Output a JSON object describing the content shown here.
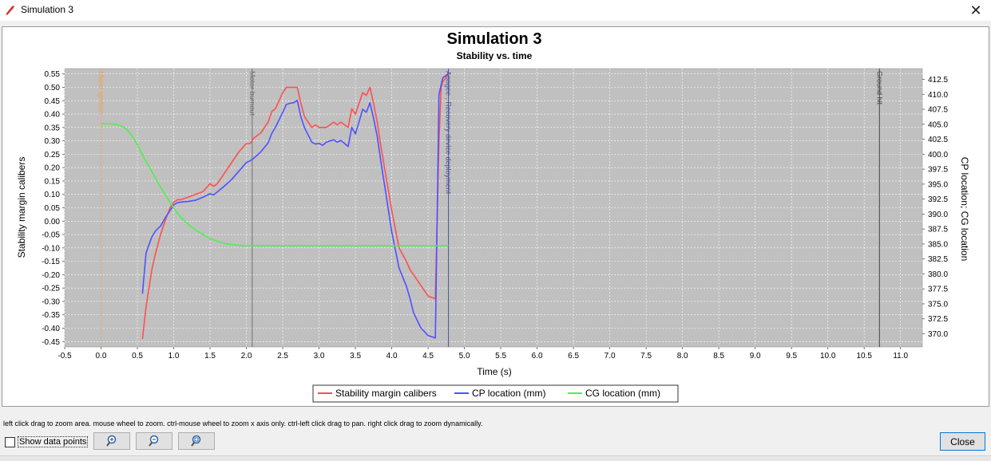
{
  "window": {
    "title": "Simulation 3",
    "close_glyph": "✕"
  },
  "chart_data": {
    "type": "line",
    "title": "Simulation 3",
    "subtitle": "Stability vs. time",
    "xlabel": "Time (s)",
    "ylabel_left": "Stability margin calibers",
    "ylabel_right": "CP location; CG location",
    "xlim": [
      -0.5,
      11.3
    ],
    "ylim_left": [
      -0.47,
      0.57
    ],
    "ylim_right": [
      367.8,
      414.3
    ],
    "grid": true,
    "legend_position": "bottom",
    "x_ticks": [
      "-0.5",
      "0.0",
      "0.5",
      "1.0",
      "1.5",
      "2.0",
      "2.5",
      "3.0",
      "3.5",
      "4.0",
      "4.5",
      "5.0",
      "5.5",
      "6.0",
      "6.5",
      "7.0",
      "7.5",
      "8.0",
      "8.5",
      "9.0",
      "9.5",
      "10.0",
      "10.5",
      "11.0"
    ],
    "y_left_ticks": [
      "0.55",
      "0.50",
      "0.45",
      "0.40",
      "0.35",
      "0.30",
      "0.25",
      "0.20",
      "0.15",
      "0.10",
      "0.05",
      "0.00",
      "-0.05",
      "-0.10",
      "-0.15",
      "-0.20",
      "-0.25",
      "-0.30",
      "-0.35",
      "-0.40",
      "-0.45"
    ],
    "y_right_ticks": [
      "412.5",
      "410.0",
      "407.5",
      "405.0",
      "402.5",
      "400.0",
      "397.5",
      "395.0",
      "392.5",
      "390.0",
      "387.5",
      "385.0",
      "382.5",
      "380.0",
      "377.5",
      "375.0",
      "372.5",
      "370.0"
    ],
    "events": [
      {
        "label": "Motor ignition",
        "x": 0.0,
        "color": "#e8a45c"
      },
      {
        "label": "Motor burnout",
        "x": 2.08,
        "color": "#707070"
      },
      {
        "label": "Apogee , Recovery device deployment",
        "x": 4.78,
        "color": "#5050a0"
      },
      {
        "label": "Ground hit",
        "x": 10.71,
        "color": "#444444"
      }
    ],
    "series": [
      {
        "name": "Stability margin calibers",
        "axis": "left",
        "color": "#ff4f4f",
        "x": [
          0.57,
          0.62,
          0.7,
          0.75,
          0.82,
          0.88,
          0.95,
          1.0,
          1.05,
          1.1,
          1.2,
          1.3,
          1.4,
          1.5,
          1.55,
          1.6,
          1.7,
          1.8,
          1.9,
          2.0,
          2.05,
          2.1,
          2.2,
          2.3,
          2.35,
          2.4,
          2.5,
          2.55,
          2.6,
          2.65,
          2.7,
          2.75,
          2.8,
          2.9,
          2.95,
          3.0,
          3.05,
          3.1,
          3.2,
          3.25,
          3.3,
          3.4,
          3.45,
          3.5,
          3.55,
          3.6,
          3.65,
          3.7,
          3.75,
          3.8,
          3.85,
          3.9,
          4.0,
          4.1,
          4.2,
          4.25,
          4.3,
          4.4,
          4.5,
          4.6,
          4.65,
          4.68,
          4.7,
          4.73,
          4.78
        ],
        "values": [
          -0.44,
          -0.32,
          -0.18,
          -0.12,
          -0.05,
          0.0,
          0.05,
          0.07,
          0.08,
          0.08,
          0.09,
          0.1,
          0.11,
          0.14,
          0.13,
          0.14,
          0.18,
          0.22,
          0.26,
          0.29,
          0.29,
          0.31,
          0.33,
          0.37,
          0.41,
          0.42,
          0.48,
          0.5,
          0.5,
          0.5,
          0.5,
          0.44,
          0.39,
          0.35,
          0.36,
          0.35,
          0.35,
          0.35,
          0.37,
          0.36,
          0.37,
          0.35,
          0.42,
          0.4,
          0.44,
          0.48,
          0.47,
          0.5,
          0.44,
          0.37,
          0.28,
          0.2,
          0.04,
          -0.1,
          -0.15,
          -0.18,
          -0.2,
          -0.24,
          -0.28,
          -0.29,
          0.3,
          0.5,
          0.52,
          0.53,
          0.55
        ]
      },
      {
        "name": "CP location (mm)",
        "axis": "right",
        "color": "#5050ff",
        "x": [
          0.57,
          0.62,
          0.7,
          0.75,
          0.82,
          0.88,
          0.95,
          1.0,
          1.05,
          1.1,
          1.2,
          1.3,
          1.4,
          1.5,
          1.55,
          1.6,
          1.7,
          1.8,
          1.9,
          2.0,
          2.05,
          2.1,
          2.2,
          2.3,
          2.35,
          2.4,
          2.5,
          2.55,
          2.6,
          2.65,
          2.7,
          2.75,
          2.8,
          2.9,
          2.95,
          3.0,
          3.05,
          3.1,
          3.2,
          3.25,
          3.3,
          3.4,
          3.45,
          3.5,
          3.55,
          3.6,
          3.65,
          3.7,
          3.75,
          3.8,
          3.85,
          3.9,
          4.0,
          4.1,
          4.2,
          4.25,
          4.3,
          4.4,
          4.5,
          4.6,
          4.65,
          4.68,
          4.7,
          4.73,
          4.78
        ],
        "values": [
          376.7,
          383.5,
          386.2,
          387.2,
          388.0,
          389.3,
          390.6,
          391.5,
          391.9,
          392.0,
          392.1,
          392.3,
          392.8,
          393.4,
          393.2,
          393.7,
          394.7,
          395.8,
          397.2,
          398.6,
          398.9,
          399.3,
          400.4,
          401.9,
          403.5,
          404.5,
          407.0,
          408.3,
          408.5,
          408.6,
          409.0,
          406.2,
          404.4,
          402.0,
          401.7,
          401.8,
          401.5,
          402.0,
          402.4,
          402.0,
          402.3,
          401.3,
          404.5,
          403.4,
          405.4,
          407.5,
          407.0,
          408.6,
          406.0,
          403.0,
          398.8,
          394.9,
          387.0,
          381.0,
          378.0,
          376.0,
          373.5,
          371.0,
          369.7,
          369.3,
          410.0,
          411.6,
          412.7,
          413.0,
          413.5
        ]
      },
      {
        "name": "CG location (mm)",
        "axis": "right",
        "color": "#4ef04e",
        "x": [
          0.0,
          0.1,
          0.2,
          0.3,
          0.35,
          0.4,
          0.45,
          0.5,
          0.55,
          0.6,
          0.7,
          0.8,
          0.9,
          1.0,
          1.1,
          1.2,
          1.3,
          1.4,
          1.5,
          1.6,
          1.7,
          1.8,
          1.9,
          2.0,
          2.08,
          4.78
        ],
        "values": [
          405.1,
          405.1,
          405.0,
          404.6,
          404.2,
          403.5,
          402.6,
          401.6,
          400.4,
          399.2,
          397.1,
          394.9,
          392.9,
          391.0,
          389.4,
          388.3,
          387.3,
          386.6,
          385.9,
          385.5,
          385.1,
          384.9,
          384.8,
          384.7,
          384.7,
          384.7
        ]
      }
    ]
  },
  "hint": "left click drag to zoom area. mouse wheel to zoom. ctrl-mouse wheel to zoom x axis only. ctrl-left click drag to pan.  right click drag to zoom dynamically.",
  "controls": {
    "show_points_label": "Show data points",
    "zoom_buttons": [
      "zoom-in-icon",
      "zoom-out-icon",
      "zoom-fit-icon"
    ],
    "close_label": "Close"
  }
}
